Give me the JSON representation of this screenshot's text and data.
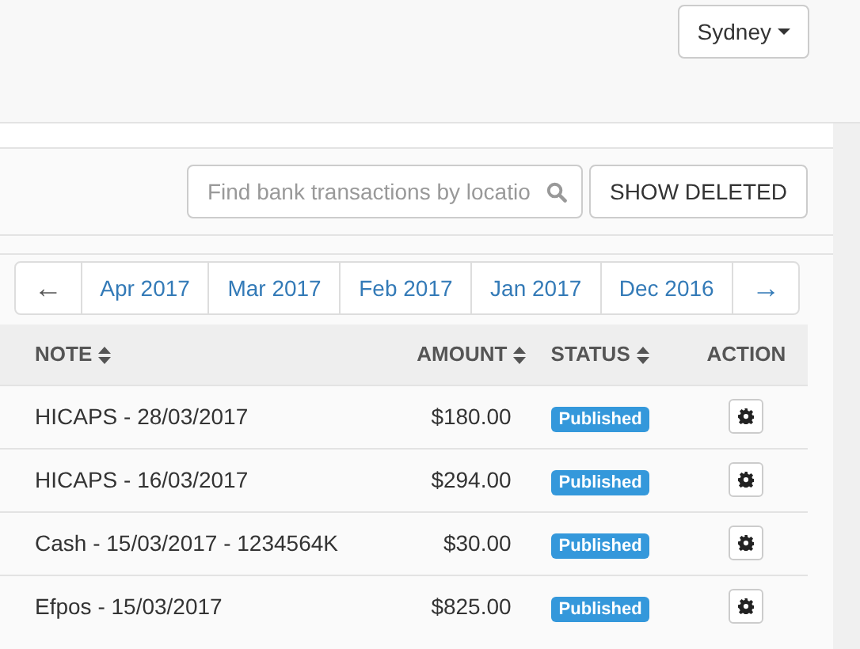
{
  "location_menu": {
    "label": "Sydney"
  },
  "search": {
    "placeholder": "Find bank transactions by locatio"
  },
  "show_deleted_button": "SHOW DELETED",
  "pager": [
    {
      "kind": "prev",
      "label": "←",
      "disabled": true
    },
    {
      "kind": "page",
      "label": "Apr 2017"
    },
    {
      "kind": "page",
      "label": "Mar 2017"
    },
    {
      "kind": "page",
      "label": "Feb 2017"
    },
    {
      "kind": "page",
      "label": "Jan 2017"
    },
    {
      "kind": "page",
      "label": "Dec 2016"
    },
    {
      "kind": "next",
      "label": "→",
      "disabled": false
    }
  ],
  "table": {
    "columns": [
      {
        "label": "NOTE",
        "sortable": true
      },
      {
        "label": "AMOUNT",
        "sortable": true
      },
      {
        "label": "STATUS",
        "sortable": true
      },
      {
        "label": "ACTION",
        "sortable": false
      }
    ],
    "rows": [
      {
        "note": "HICAPS - 28/03/2017",
        "amount": "$180.00",
        "status": "Published"
      },
      {
        "note": "HICAPS - 16/03/2017",
        "amount": "$294.00",
        "status": "Published"
      },
      {
        "note": "Cash - 15/03/2017 - 1234564K",
        "amount": "$30.00",
        "status": "Published"
      },
      {
        "note": "Efpos - 15/03/2017",
        "amount": "$825.00",
        "status": "Published"
      }
    ]
  }
}
